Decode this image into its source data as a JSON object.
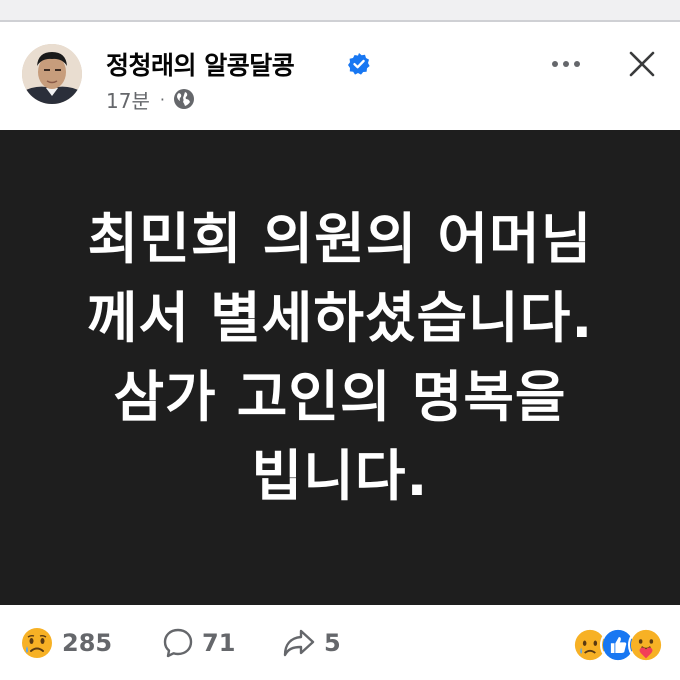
{
  "post": {
    "author": "정청래의 알콩달콩",
    "time": "17분",
    "separator": "·",
    "icons": {
      "verified": "verified-badge-icon",
      "privacy": "globe-icon",
      "more": "more-options-icon",
      "close": "close-icon"
    },
    "colors": {
      "verified": "#1877f2",
      "image_bg": "#1e1e1e",
      "secondary_text": "#65676b"
    },
    "image_text_lines": [
      "최민희 의원의 어머님",
      "께서 별세하셨습니다.",
      "삼가 고인의 명복을",
      "빕니다."
    ]
  },
  "footer": {
    "reaction_count": "285",
    "comment_count": "71",
    "share_count": "5",
    "icons": {
      "reaction": "sad-emoji-icon",
      "comment": "comment-icon",
      "share": "share-icon",
      "cluster": [
        "sad-reaction-icon",
        "like-reaction-icon",
        "care-reaction-icon"
      ]
    }
  }
}
